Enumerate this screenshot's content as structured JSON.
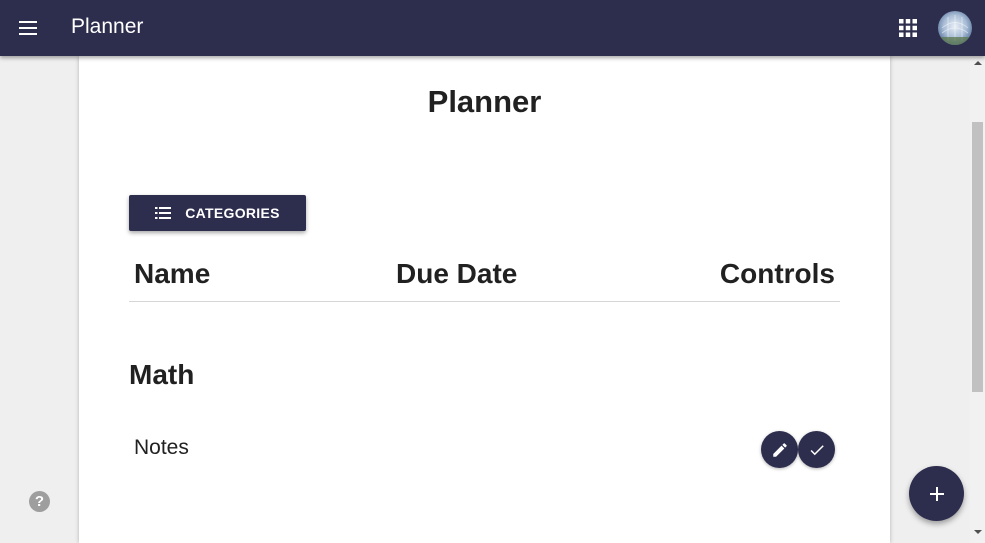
{
  "appbar": {
    "title": "Planner",
    "menu_icon": "menu-icon",
    "apps_icon": "apps-grid-icon",
    "avatar": "user-avatar"
  },
  "page": {
    "title": "Planner",
    "categories_button": {
      "label": "CATEGORIES",
      "icon": "list-icon"
    }
  },
  "table": {
    "headers": {
      "name": "Name",
      "due_date": "Due Date",
      "controls": "Controls"
    }
  },
  "groups": [
    {
      "title": "Math",
      "items": [
        {
          "name": "Notes",
          "due_date": "",
          "controls": [
            "edit-icon",
            "check-icon"
          ]
        }
      ]
    }
  ],
  "help": {
    "label": "?"
  },
  "fab": {
    "icon": "add-icon"
  },
  "colors": {
    "primary": "#2d2d4e",
    "background": "#efefef",
    "card": "#ffffff"
  }
}
